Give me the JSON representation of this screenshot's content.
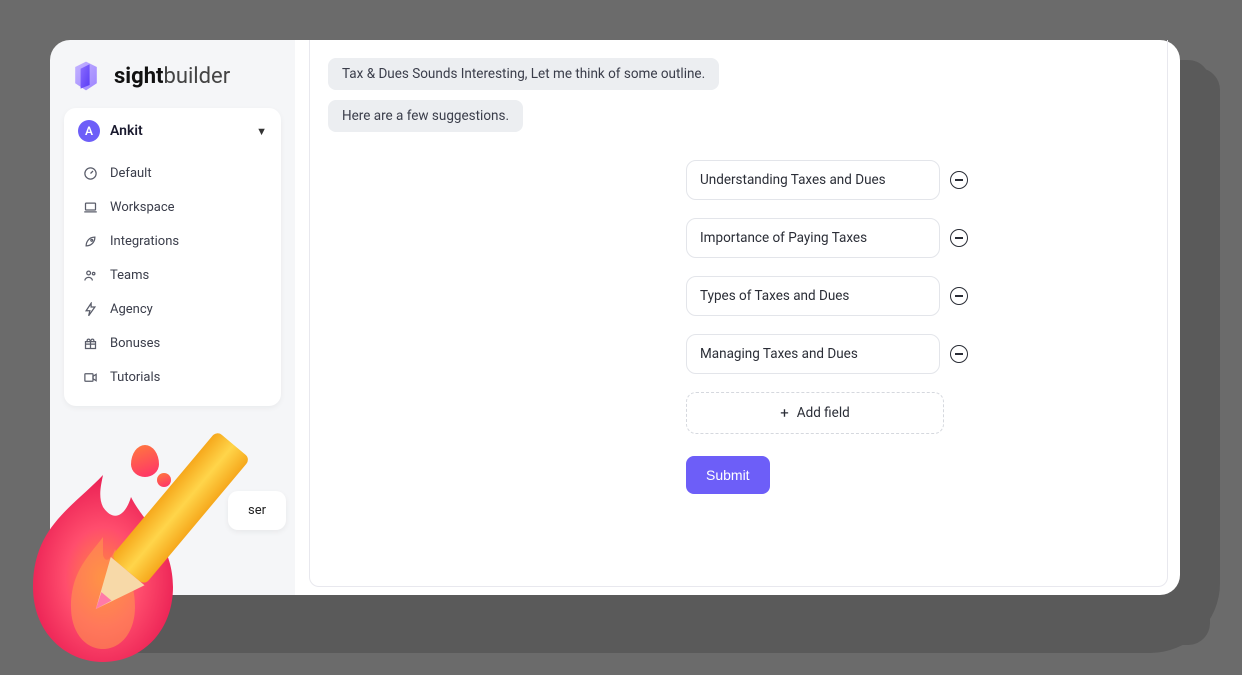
{
  "brand": {
    "part1": "sight",
    "part2": "builder"
  },
  "user": {
    "initial": "A",
    "name": "Ankit"
  },
  "sidebar": {
    "items": [
      {
        "icon": "gauge-icon",
        "label": "Default"
      },
      {
        "icon": "laptop-icon",
        "label": "Workspace"
      },
      {
        "icon": "rocket-icon",
        "label": "Integrations"
      },
      {
        "icon": "people-icon",
        "label": "Teams"
      },
      {
        "icon": "bolt-icon",
        "label": "Agency"
      },
      {
        "icon": "gift-icon",
        "label": "Bonuses"
      },
      {
        "icon": "video-icon",
        "label": "Tutorials"
      }
    ]
  },
  "partial_button_text": "ser",
  "chat": {
    "line1": "Tax & Dues Sounds Interesting, Let me think of some outline.",
    "line2": "Here are a few suggestions."
  },
  "suggestions": [
    "Understanding Taxes and Dues",
    "Importance of Paying Taxes",
    "Types of Taxes and Dues",
    "Managing Taxes and Dues"
  ],
  "add_field_label": "Add field",
  "submit_label": "Submit"
}
